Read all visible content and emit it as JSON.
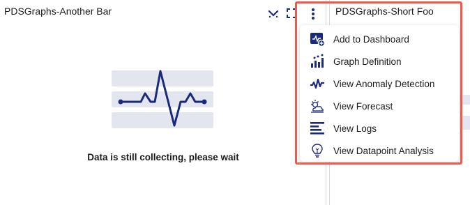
{
  "left_panel": {
    "title": "PDSGraphs-Another Bar",
    "empty_message": "Data is still collecting, please wait"
  },
  "right_panel": {
    "title": "PDSGraphs-Short Foo"
  },
  "menu": {
    "items": [
      {
        "label": "Add to Dashboard",
        "icon": "add-to-dashboard-icon"
      },
      {
        "label": "Graph Definition",
        "icon": "graph-definition-icon"
      },
      {
        "label": "View Anomaly Detection",
        "icon": "anomaly-detection-icon"
      },
      {
        "label": "View Forecast",
        "icon": "forecast-icon"
      },
      {
        "label": "View Logs",
        "icon": "logs-icon"
      },
      {
        "label": "View Datapoint Analysis",
        "icon": "datapoint-analysis-icon"
      }
    ]
  },
  "colors": {
    "accent": "#1b2a7a",
    "highlight": "#f15a4a",
    "placeholder": "#e3e6ee"
  }
}
